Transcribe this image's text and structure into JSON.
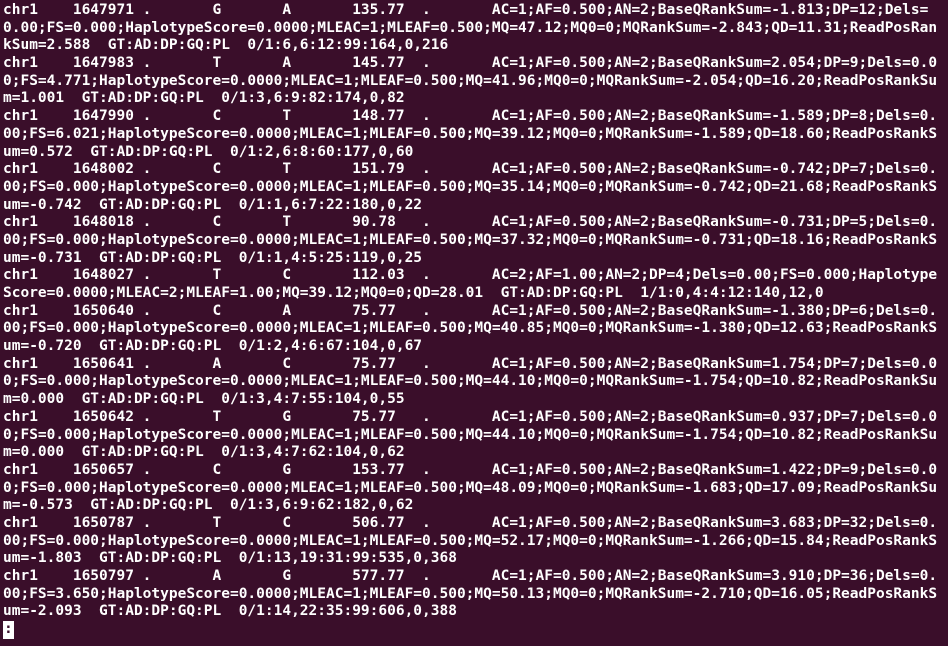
{
  "records": [
    {
      "chrom": "chr1",
      "pos": "1647971",
      "id": ".",
      "ref": "G",
      "alt": "A",
      "qual": "135.77",
      "filter": ".",
      "info": "AC=1;AF=0.500;AN=2;BaseQRankSum=-1.813;DP=12;Dels=0.00;FS=0.000;HaplotypeScore=0.0000;MLEAC=1;MLEAF=0.500;MQ=47.12;MQ0=0;MQRankSum=-2.843;QD=11.31;ReadPosRankSum=2.588",
      "format": "GT:AD:DP:GQ:PL",
      "sample": "0/1:6,6:12:99:164,0,216"
    },
    {
      "chrom": "chr1",
      "pos": "1647983",
      "id": ".",
      "ref": "T",
      "alt": "A",
      "qual": "145.77",
      "filter": ".",
      "info": "AC=1;AF=0.500;AN=2;BaseQRankSum=2.054;DP=9;Dels=0.00;FS=4.771;HaplotypeScore=0.0000;MLEAC=1;MLEAF=0.500;MQ=41.96;MQ0=0;MQRankSum=-2.054;QD=16.20;ReadPosRankSum=1.001",
      "format": "GT:AD:DP:GQ:PL",
      "sample": "0/1:3,6:9:82:174,0,82"
    },
    {
      "chrom": "chr1",
      "pos": "1647990",
      "id": ".",
      "ref": "C",
      "alt": "T",
      "qual": "148.77",
      "filter": ".",
      "info": "AC=1;AF=0.500;AN=2;BaseQRankSum=-1.589;DP=8;Dels=0.00;FS=6.021;HaplotypeScore=0.0000;MLEAC=1;MLEAF=0.500;MQ=39.12;MQ0=0;MQRankSum=-1.589;QD=18.60;ReadPosRankSum=0.572",
      "format": "GT:AD:DP:GQ:PL",
      "sample": "0/1:2,6:8:60:177,0,60"
    },
    {
      "chrom": "chr1",
      "pos": "1648002",
      "id": ".",
      "ref": "C",
      "alt": "T",
      "qual": "151.79",
      "filter": ".",
      "info": "AC=1;AF=0.500;AN=2;BaseQRankSum=-0.742;DP=7;Dels=0.00;FS=0.000;HaplotypeScore=0.0000;MLEAC=1;MLEAF=0.500;MQ=35.14;MQ0=0;MQRankSum=-0.742;QD=21.68;ReadPosRankSum=-0.742",
      "format": "GT:AD:DP:GQ:PL",
      "sample": "0/1:1,6:7:22:180,0,22"
    },
    {
      "chrom": "chr1",
      "pos": "1648018",
      "id": ".",
      "ref": "C",
      "alt": "T",
      "qual": "90.78",
      "filter": ".",
      "info": "AC=1;AF=0.500;AN=2;BaseQRankSum=-0.731;DP=5;Dels=0.00;FS=0.000;HaplotypeScore=0.0000;MLEAC=1;MLEAF=0.500;MQ=37.32;MQ0=0;MQRankSum=-0.731;QD=18.16;ReadPosRankSum=-0.731",
      "format": "GT:AD:DP:GQ:PL",
      "sample": "0/1:1,4:5:25:119,0,25"
    },
    {
      "chrom": "chr1",
      "pos": "1648027",
      "id": ".",
      "ref": "T",
      "alt": "C",
      "qual": "112.03",
      "filter": ".",
      "info": "AC=2;AF=1.00;AN=2;DP=4;Dels=0.00;FS=0.000;HaplotypeScore=0.0000;MLEAC=2;MLEAF=1.00;MQ=39.12;MQ0=0;QD=28.01",
      "format": "GT:AD:DP:GQ:PL",
      "sample": "1/1:0,4:4:12:140,12,0"
    },
    {
      "chrom": "chr1",
      "pos": "1650640",
      "id": ".",
      "ref": "C",
      "alt": "A",
      "qual": "75.77",
      "filter": ".",
      "info": "AC=1;AF=0.500;AN=2;BaseQRankSum=-1.380;DP=6;Dels=0.00;FS=0.000;HaplotypeScore=0.0000;MLEAC=1;MLEAF=0.500;MQ=40.85;MQ0=0;MQRankSum=-1.380;QD=12.63;ReadPosRankSum=-0.720",
      "format": "GT:AD:DP:GQ:PL",
      "sample": "0/1:2,4:6:67:104,0,67"
    },
    {
      "chrom": "chr1",
      "pos": "1650641",
      "id": ".",
      "ref": "A",
      "alt": "C",
      "qual": "75.77",
      "filter": ".",
      "info": "AC=1;AF=0.500;AN=2;BaseQRankSum=1.754;DP=7;Dels=0.00;FS=0.000;HaplotypeScore=0.0000;MLEAC=1;MLEAF=0.500;MQ=44.10;MQ0=0;MQRankSum=-1.754;QD=10.82;ReadPosRankSum=0.000",
      "format": "GT:AD:DP:GQ:PL",
      "sample": "0/1:3,4:7:55:104,0,55"
    },
    {
      "chrom": "chr1",
      "pos": "1650642",
      "id": ".",
      "ref": "T",
      "alt": "G",
      "qual": "75.77",
      "filter": ".",
      "info": "AC=1;AF=0.500;AN=2;BaseQRankSum=0.937;DP=7;Dels=0.00;FS=0.000;HaplotypeScore=0.0000;MLEAC=1;MLEAF=0.500;MQ=44.10;MQ0=0;MQRankSum=-1.754;QD=10.82;ReadPosRankSum=0.000",
      "format": "GT:AD:DP:GQ:PL",
      "sample": "0/1:3,4:7:62:104,0,62"
    },
    {
      "chrom": "chr1",
      "pos": "1650657",
      "id": ".",
      "ref": "C",
      "alt": "G",
      "qual": "153.77",
      "filter": ".",
      "info": "AC=1;AF=0.500;AN=2;BaseQRankSum=1.422;DP=9;Dels=0.00;FS=0.000;HaplotypeScore=0.0000;MLEAC=1;MLEAF=0.500;MQ=48.09;MQ0=0;MQRankSum=-1.683;QD=17.09;ReadPosRankSum=-0.573",
      "format": "GT:AD:DP:GQ:PL",
      "sample": "0/1:3,6:9:62:182,0,62"
    },
    {
      "chrom": "chr1",
      "pos": "1650787",
      "id": ".",
      "ref": "T",
      "alt": "C",
      "qual": "506.77",
      "filter": ".",
      "info": "AC=1;AF=0.500;AN=2;BaseQRankSum=3.683;DP=32;Dels=0.00;FS=0.000;HaplotypeScore=0.0000;MLEAC=1;MLEAF=0.500;MQ=52.17;MQ0=0;MQRankSum=-1.266;QD=15.84;ReadPosRankSum=-1.803",
      "format": "GT:AD:DP:GQ:PL",
      "sample": "0/1:13,19:31:99:535,0,368"
    },
    {
      "chrom": "chr1",
      "pos": "1650797",
      "id": ".",
      "ref": "A",
      "alt": "G",
      "qual": "577.77",
      "filter": ".",
      "info": "AC=1;AF=0.500;AN=2;BaseQRankSum=3.910;DP=36;Dels=0.00;FS=3.650;HaplotypeScore=0.0000;MLEAC=1;MLEAF=0.500;MQ=50.13;MQ0=0;MQRankSum=-2.710;QD=16.05;ReadPosRankSum=-2.093",
      "format": "GT:AD:DP:GQ:PL",
      "sample": "0/1:14,22:35:99:606,0,388"
    }
  ],
  "prompt": ":"
}
